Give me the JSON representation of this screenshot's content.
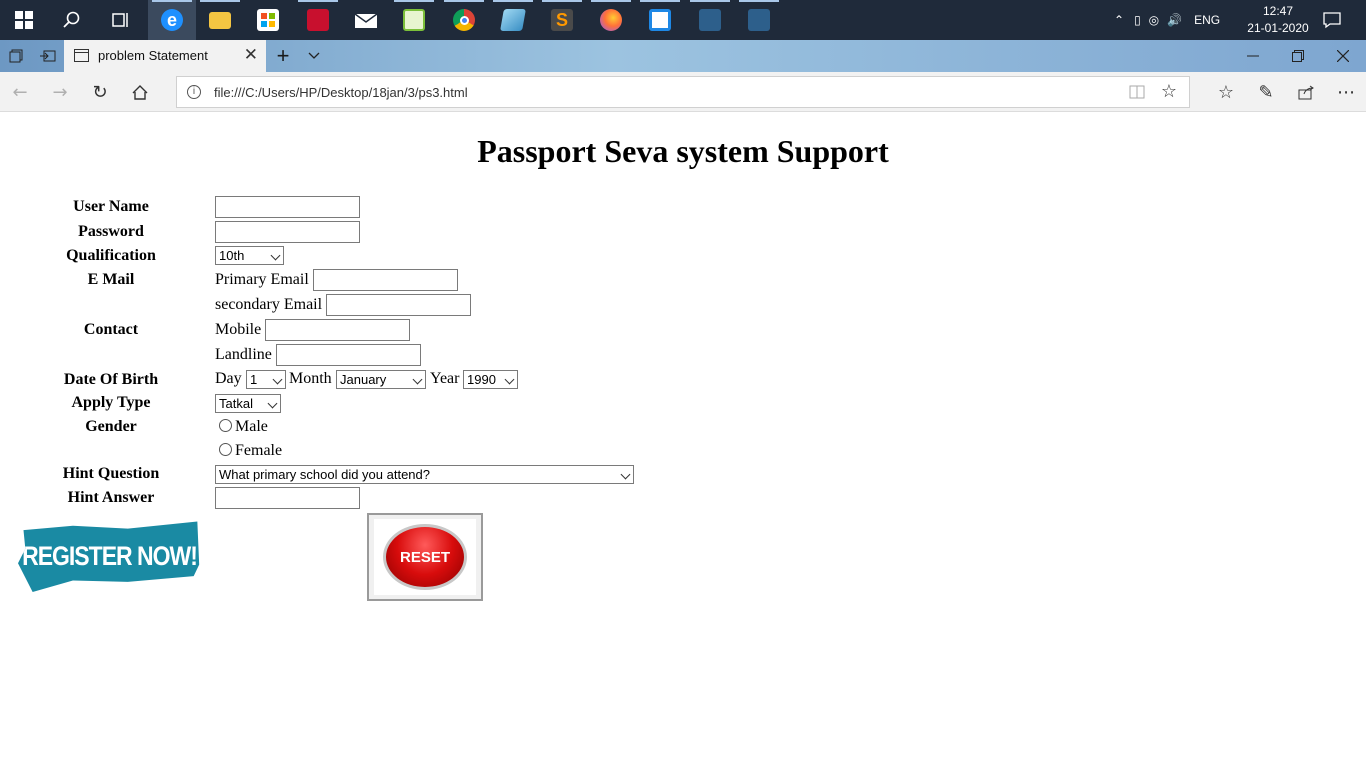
{
  "taskbar": {
    "apps": [
      "start-icon",
      "search-icon",
      "task-view-icon",
      "edge-icon",
      "file-explorer-icon",
      "store-icon",
      "acrobat-icon",
      "mail-icon",
      "notepad-plus-icon",
      "chrome-icon",
      "app-icon",
      "sublime-icon",
      "firefox-icon",
      "app-icon",
      "mysql-workbench-icon",
      "mysql-workbench-icon"
    ],
    "language": "ENG",
    "time": "12:47",
    "date": "21-01-2020"
  },
  "browser": {
    "tab_title": "problem Statement",
    "url": "file:///C:/Users/HP/Desktop/18jan/3/ps3.html"
  },
  "page": {
    "title": "Passport Seva system Support",
    "labels": {
      "username": "User Name",
      "password": "Password",
      "qualification": "Qualification",
      "email": "E Mail",
      "contact": "Contact",
      "dob": "Date Of Birth",
      "apply_type": "Apply Type",
      "gender": "Gender",
      "hint_question": "Hint Question",
      "hint_answer": "Hint Answer"
    },
    "qualification_value": "10th",
    "primary_email_label": "Primary Email",
    "secondary_email_label": "secondary Email",
    "mobile_label": "Mobile",
    "landline_label": "Landline",
    "day_label": "Day",
    "day_value": "1",
    "month_label": "Month",
    "month_value": "January",
    "year_label": "Year",
    "year_value": "1990",
    "apply_type_value": "Tatkal",
    "gender_male": "Male",
    "gender_female": "Female",
    "hint_question_value": "What primary school did you attend?",
    "register_text": "REGISTER NOW!",
    "reset_text": "RESET"
  }
}
